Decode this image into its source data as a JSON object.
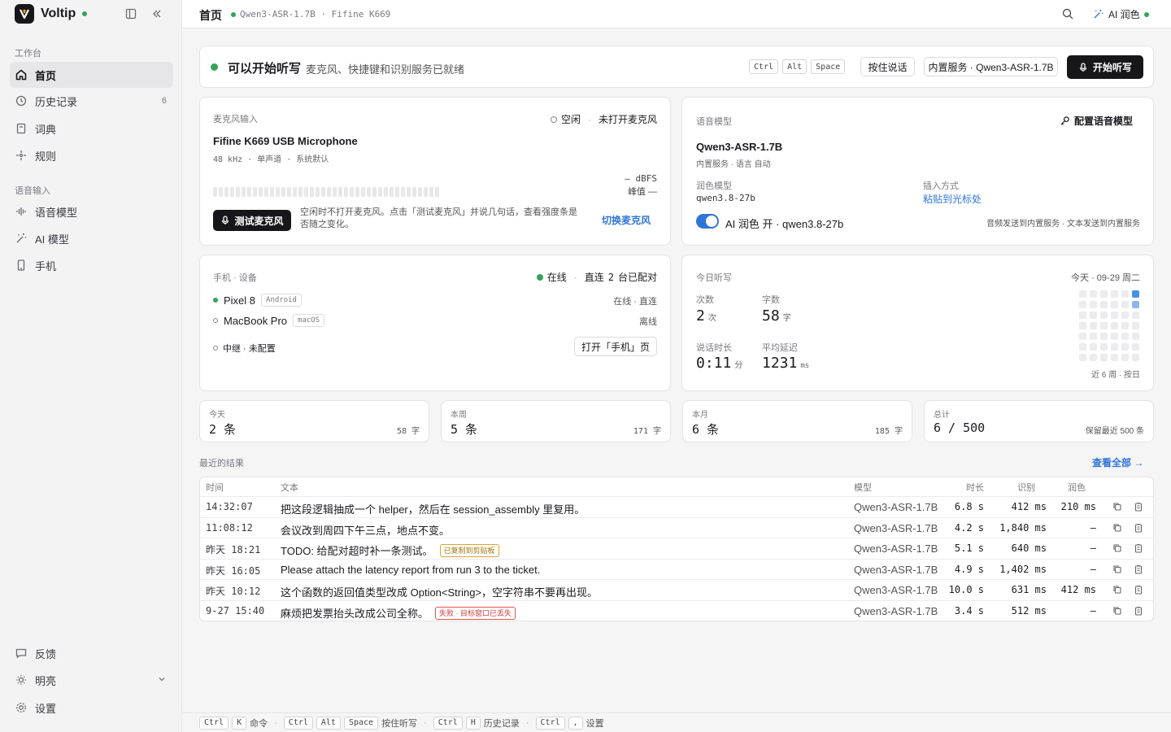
{
  "sidebar": {
    "brand": "Voltip",
    "sections": {
      "workspace": "工作台",
      "voice": "语音输入"
    },
    "items": [
      {
        "label": "首页",
        "icon": "home-icon",
        "active": true
      },
      {
        "label": "历史记录",
        "icon": "history-icon",
        "count": "6"
      },
      {
        "label": "词典",
        "icon": "book-icon"
      },
      {
        "label": "规则",
        "icon": "rules-icon"
      },
      {
        "label": "语音模型",
        "icon": "waveform-icon"
      },
      {
        "label": "AI 模型",
        "icon": "magic-wand-icon"
      },
      {
        "label": "手机",
        "icon": "phone-icon"
      }
    ],
    "bottom": {
      "feedback": "反馈",
      "theme": "明亮",
      "settings": "设置"
    }
  },
  "header": {
    "title": "首页",
    "subtitle": "Qwen3-ASR-1.7B · Fifine K669",
    "ai_label": "AI 润色"
  },
  "status": {
    "title": "可以开始听写",
    "desc": "麦克风、快捷键和识别服务已就绪",
    "keys": [
      "Ctrl",
      "Alt",
      "Space"
    ],
    "hold_label": "按住说话",
    "service_label": "内置服务 · Qwen3-ASR-1.7B",
    "start_label": "开始听写"
  },
  "mic": {
    "section": "麦克风输入",
    "state": "空闲",
    "state_detail": "未打开麦克风",
    "device": "Fifine K669 USB Microphone",
    "specs": "48 kHz · 单声道 · 系统默认",
    "dbfs": "— dBFS",
    "peak": "峰值 —",
    "test_label": "测试麦克风",
    "hint": "空闲时不打开麦克风。点击「测试麦克风」并说几句话，查看强度条是否随之变化。",
    "switch_label": "切换麦克风"
  },
  "model": {
    "section": "语音模型",
    "config_label": "配置语音模型",
    "name": "Qwen3-ASR-1.7B",
    "meta": "内置服务 · 语言 自动",
    "polish_label": "润色模型",
    "polish_value": "qwen3.8-27b",
    "insert_label": "插入方式",
    "insert_value": "粘贴到光标处",
    "toggle_label": "AI 润色 开 · qwen3.8-27b",
    "routing": "音频发送到内置服务 · 文本发送到内置服务"
  },
  "devices": {
    "section": "手机 · 设备",
    "online": "在线",
    "direct": "直连",
    "paired_count": "2",
    "paired_suffix": "台已配对",
    "list": [
      {
        "name": "Pixel 8",
        "os": "Android",
        "status": "在线 · 直连"
      },
      {
        "name": "MacBook Pro",
        "os": "macOS",
        "status": "离线"
      }
    ],
    "relay": "中继 · 未配置",
    "open_label": "打开「手机」页"
  },
  "today": {
    "section": "今日听写",
    "date": "今天 · 09-29 周二",
    "count_label": "次数",
    "count": "2",
    "count_unit": "次",
    "chars_label": "字数",
    "chars": "58",
    "chars_unit": "字",
    "duration_label": "说话时长",
    "duration": "0:11",
    "duration_unit": "分",
    "latency_label": "平均延迟",
    "latency": "1231",
    "latency_unit": "ms",
    "heat_caption": "近 6 周 · 按日"
  },
  "stats": [
    {
      "label": "今天",
      "value": "2 条",
      "extra": "58 字"
    },
    {
      "label": "本周",
      "value": "5 条",
      "extra": "171 字"
    },
    {
      "label": "本月",
      "value": "6 条",
      "extra": "185 字"
    },
    {
      "label": "总计",
      "value": "6 / 500",
      "extra": "保留最近 500 条"
    }
  ],
  "recent": {
    "title": "最近的结果",
    "view_all": "查看全部 →",
    "columns": {
      "time": "时间",
      "text": "文本",
      "model": "模型",
      "duration": "时长",
      "asr": "识别",
      "polish": "润色"
    },
    "rows": [
      {
        "time": "14:32:07",
        "text": "把这段逻辑抽成一个 helper，然后在 session_assembly 里复用。",
        "model": "Qwen3-ASR-1.7B",
        "duration": "6.8 s",
        "asr": "412 ms",
        "polish": "210 ms"
      },
      {
        "time": "11:08:12",
        "text": "会议改到周四下午三点，地点不变。",
        "model": "Qwen3-ASR-1.7B",
        "duration": "4.2 s",
        "asr": "1,840 ms",
        "polish": "—"
      },
      {
        "time": "昨天 18:21",
        "text": "TODO: 给配对超时补一条测试。",
        "badge": "已复制到剪贴板",
        "model": "Qwen3-ASR-1.7B",
        "duration": "5.1 s",
        "asr": "640 ms",
        "polish": "—"
      },
      {
        "time": "昨天 16:05",
        "text": "Please attach the latency report from run 3 to the ticket.",
        "model": "Qwen3-ASR-1.7B",
        "duration": "4.9 s",
        "asr": "1,402 ms",
        "polish": "—"
      },
      {
        "time": "昨天 10:12",
        "text": "这个函数的返回值类型改成 Option<String>，空字符串不要再出现。",
        "model": "Qwen3-ASR-1.7B",
        "duration": "10.0 s",
        "asr": "631 ms",
        "polish": "412 ms"
      },
      {
        "time": "9-27 15:40",
        "text": "麻烦把发票抬头改成公司全称。",
        "badge_error": "失败 · 目标窗口已丢失",
        "model": "Qwen3-ASR-1.7B",
        "duration": "3.4 s",
        "asr": "512 ms",
        "polish": "—"
      }
    ]
  },
  "footer": {
    "cmd": "命令",
    "hold": "按住听写",
    "history": "历史记录",
    "settings": "设置",
    "keys": {
      "ctrl": "Ctrl",
      "k": "K",
      "alt": "Alt",
      "space": "Space",
      "h": "H",
      "comma": ","
    }
  },
  "colors": {
    "accent": "#2f74d8",
    "online": "#34a35a",
    "warn": "#d8a62a",
    "error": "#e05353"
  }
}
